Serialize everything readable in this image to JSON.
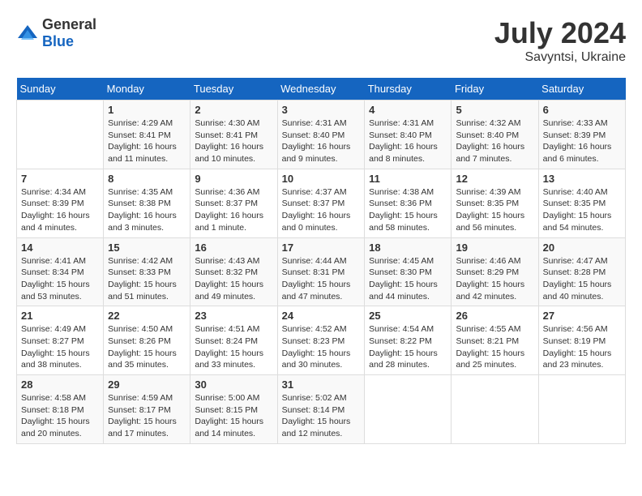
{
  "header": {
    "logo_general": "General",
    "logo_blue": "Blue",
    "month_year": "July 2024",
    "location": "Savyntsi, Ukraine"
  },
  "days_of_week": [
    "Sunday",
    "Monday",
    "Tuesday",
    "Wednesday",
    "Thursday",
    "Friday",
    "Saturday"
  ],
  "weeks": [
    [
      {
        "day": "",
        "info": ""
      },
      {
        "day": "1",
        "info": "Sunrise: 4:29 AM\nSunset: 8:41 PM\nDaylight: 16 hours\nand 11 minutes."
      },
      {
        "day": "2",
        "info": "Sunrise: 4:30 AM\nSunset: 8:41 PM\nDaylight: 16 hours\nand 10 minutes."
      },
      {
        "day": "3",
        "info": "Sunrise: 4:31 AM\nSunset: 8:40 PM\nDaylight: 16 hours\nand 9 minutes."
      },
      {
        "day": "4",
        "info": "Sunrise: 4:31 AM\nSunset: 8:40 PM\nDaylight: 16 hours\nand 8 minutes."
      },
      {
        "day": "5",
        "info": "Sunrise: 4:32 AM\nSunset: 8:40 PM\nDaylight: 16 hours\nand 7 minutes."
      },
      {
        "day": "6",
        "info": "Sunrise: 4:33 AM\nSunset: 8:39 PM\nDaylight: 16 hours\nand 6 minutes."
      }
    ],
    [
      {
        "day": "7",
        "info": "Sunrise: 4:34 AM\nSunset: 8:39 PM\nDaylight: 16 hours\nand 4 minutes."
      },
      {
        "day": "8",
        "info": "Sunrise: 4:35 AM\nSunset: 8:38 PM\nDaylight: 16 hours\nand 3 minutes."
      },
      {
        "day": "9",
        "info": "Sunrise: 4:36 AM\nSunset: 8:37 PM\nDaylight: 16 hours\nand 1 minute."
      },
      {
        "day": "10",
        "info": "Sunrise: 4:37 AM\nSunset: 8:37 PM\nDaylight: 16 hours\nand 0 minutes."
      },
      {
        "day": "11",
        "info": "Sunrise: 4:38 AM\nSunset: 8:36 PM\nDaylight: 15 hours\nand 58 minutes."
      },
      {
        "day": "12",
        "info": "Sunrise: 4:39 AM\nSunset: 8:35 PM\nDaylight: 15 hours\nand 56 minutes."
      },
      {
        "day": "13",
        "info": "Sunrise: 4:40 AM\nSunset: 8:35 PM\nDaylight: 15 hours\nand 54 minutes."
      }
    ],
    [
      {
        "day": "14",
        "info": "Sunrise: 4:41 AM\nSunset: 8:34 PM\nDaylight: 15 hours\nand 53 minutes."
      },
      {
        "day": "15",
        "info": "Sunrise: 4:42 AM\nSunset: 8:33 PM\nDaylight: 15 hours\nand 51 minutes."
      },
      {
        "day": "16",
        "info": "Sunrise: 4:43 AM\nSunset: 8:32 PM\nDaylight: 15 hours\nand 49 minutes."
      },
      {
        "day": "17",
        "info": "Sunrise: 4:44 AM\nSunset: 8:31 PM\nDaylight: 15 hours\nand 47 minutes."
      },
      {
        "day": "18",
        "info": "Sunrise: 4:45 AM\nSunset: 8:30 PM\nDaylight: 15 hours\nand 44 minutes."
      },
      {
        "day": "19",
        "info": "Sunrise: 4:46 AM\nSunset: 8:29 PM\nDaylight: 15 hours\nand 42 minutes."
      },
      {
        "day": "20",
        "info": "Sunrise: 4:47 AM\nSunset: 8:28 PM\nDaylight: 15 hours\nand 40 minutes."
      }
    ],
    [
      {
        "day": "21",
        "info": "Sunrise: 4:49 AM\nSunset: 8:27 PM\nDaylight: 15 hours\nand 38 minutes."
      },
      {
        "day": "22",
        "info": "Sunrise: 4:50 AM\nSunset: 8:26 PM\nDaylight: 15 hours\nand 35 minutes."
      },
      {
        "day": "23",
        "info": "Sunrise: 4:51 AM\nSunset: 8:24 PM\nDaylight: 15 hours\nand 33 minutes."
      },
      {
        "day": "24",
        "info": "Sunrise: 4:52 AM\nSunset: 8:23 PM\nDaylight: 15 hours\nand 30 minutes."
      },
      {
        "day": "25",
        "info": "Sunrise: 4:54 AM\nSunset: 8:22 PM\nDaylight: 15 hours\nand 28 minutes."
      },
      {
        "day": "26",
        "info": "Sunrise: 4:55 AM\nSunset: 8:21 PM\nDaylight: 15 hours\nand 25 minutes."
      },
      {
        "day": "27",
        "info": "Sunrise: 4:56 AM\nSunset: 8:19 PM\nDaylight: 15 hours\nand 23 minutes."
      }
    ],
    [
      {
        "day": "28",
        "info": "Sunrise: 4:58 AM\nSunset: 8:18 PM\nDaylight: 15 hours\nand 20 minutes."
      },
      {
        "day": "29",
        "info": "Sunrise: 4:59 AM\nSunset: 8:17 PM\nDaylight: 15 hours\nand 17 minutes."
      },
      {
        "day": "30",
        "info": "Sunrise: 5:00 AM\nSunset: 8:15 PM\nDaylight: 15 hours\nand 14 minutes."
      },
      {
        "day": "31",
        "info": "Sunrise: 5:02 AM\nSunset: 8:14 PM\nDaylight: 15 hours\nand 12 minutes."
      },
      {
        "day": "",
        "info": ""
      },
      {
        "day": "",
        "info": ""
      },
      {
        "day": "",
        "info": ""
      }
    ]
  ]
}
